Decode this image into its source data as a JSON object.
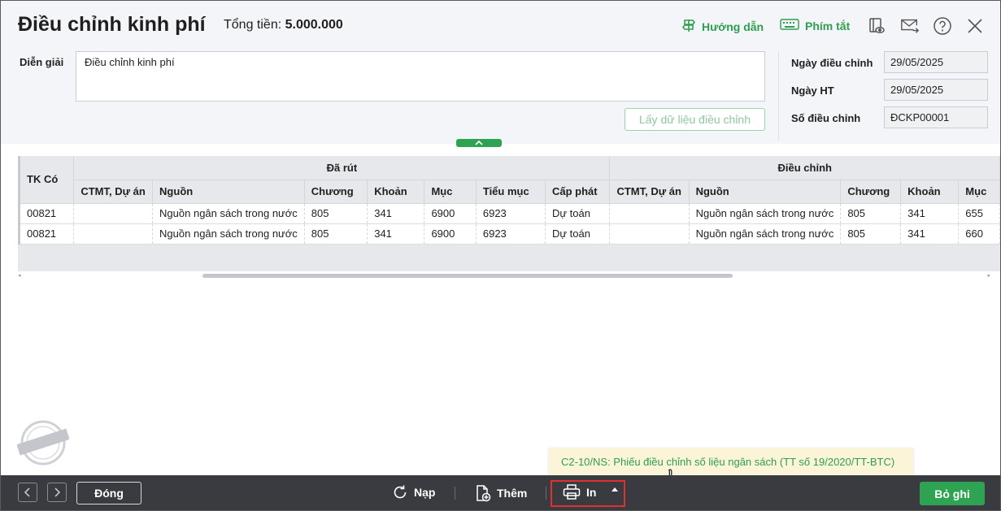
{
  "header": {
    "title": "Điều chỉnh kinh phí",
    "total_label": "Tổng tiền:",
    "total_value": "5.000.000",
    "guide_label": "Hướng dẫn",
    "shortcut_label": "Phím tắt",
    "icons": [
      "view-settings-icon",
      "mail-icon",
      "help-icon",
      "close-icon"
    ]
  },
  "form": {
    "description_label": "Diễn giải",
    "description_value": "Điều chỉnh kinh phí",
    "fetch_button": "Lấy dữ liệu điều chỉnh",
    "adjust_date_label": "Ngày điều chỉnh",
    "adjust_date_value": "29/05/2025",
    "ht_date_label": "Ngày HT",
    "ht_date_value": "29/05/2025",
    "adjust_no_label": "Số điều chỉnh",
    "adjust_no_value": "ĐCKP00001"
  },
  "grid": {
    "first_col": "TK Có",
    "group_withdrawn": "Đã rút",
    "group_adjust": "Điều chỉnh",
    "withdrawn_cols": [
      "CTMT, Dự án",
      "Nguồn",
      "Chương",
      "Khoản",
      "Mục",
      "Tiểu mục",
      "Cấp phát"
    ],
    "adjust_cols": [
      "CTMT, Dự án",
      "Nguồn",
      "Chương",
      "Khoản",
      "Mục"
    ],
    "rows": [
      [
        "00821",
        "",
        "Nguồn ngân sách trong nước",
        "805",
        "341",
        "6900",
        "6923",
        "Dự toán",
        "",
        "Nguồn ngân sách trong nước",
        "805",
        "341",
        "655"
      ],
      [
        "00821",
        "",
        "Nguồn ngân sách trong nước",
        "805",
        "341",
        "6900",
        "6923",
        "Dự toán",
        "",
        "Nguồn ngân sách trong nước",
        "805",
        "341",
        "660"
      ]
    ]
  },
  "watermark": "DỮ LIỆU MẪU",
  "tooltip": "C2-10/NS: Phiếu điều chỉnh số liệu ngân sách (TT số 19/2020/TT-BTC)",
  "footer": {
    "close_label": "Đóng",
    "reload_label": "Nạp",
    "add_label": "Thêm",
    "print_label": "In",
    "save_label": "Bỏ ghi"
  },
  "colors": {
    "accent_green": "#2ea352",
    "footer_bg": "#3a3b41",
    "tooltip_bg": "#fbf4d8",
    "highlight_red": "#e03131"
  }
}
